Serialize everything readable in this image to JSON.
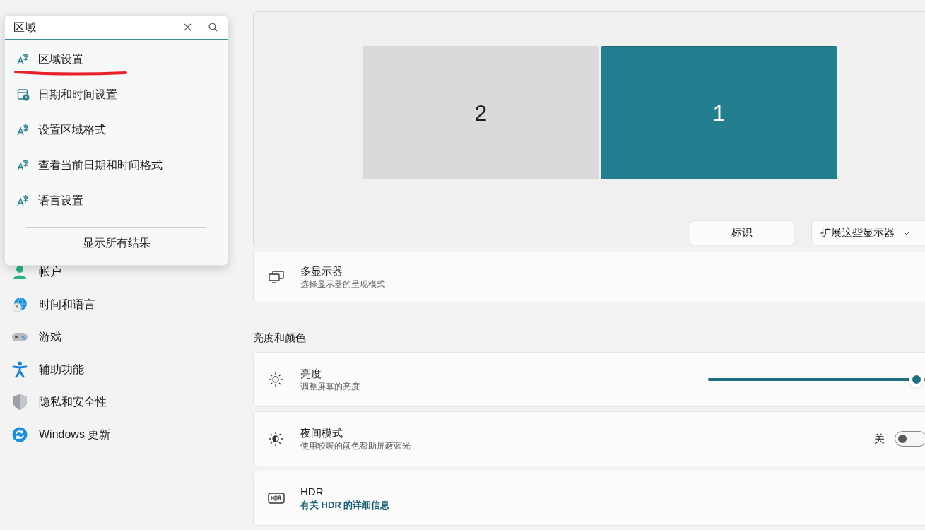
{
  "search": {
    "value": "区域",
    "results": [
      {
        "kind": "language",
        "label": "区域设置",
        "underlined": true
      },
      {
        "kind": "calendar",
        "label": "日期和时间设置",
        "underlined": false
      },
      {
        "kind": "language",
        "label": "设置区域格式",
        "underlined": false
      },
      {
        "kind": "language",
        "label": "查看当前日期和时间格式",
        "underlined": false
      },
      {
        "kind": "language",
        "label": "语言设置",
        "underlined": false
      }
    ],
    "show_all": "显示所有结果"
  },
  "sidebar": {
    "items": [
      {
        "kind": "account",
        "label": "帐户"
      },
      {
        "kind": "time",
        "label": "时间和语言"
      },
      {
        "kind": "gaming",
        "label": "游戏"
      },
      {
        "kind": "accessibility",
        "label": "辅助功能"
      },
      {
        "kind": "privacy",
        "label": "隐私和安全性"
      },
      {
        "kind": "update",
        "label": "Windows 更新"
      }
    ]
  },
  "display": {
    "monitors": [
      {
        "label": "2",
        "selected": false
      },
      {
        "label": "1",
        "selected": true
      }
    ],
    "identify": "标识",
    "mode": "扩展这些显示器"
  },
  "multi_display": {
    "title": "多显示器",
    "subtitle": "选择显示器的呈现模式"
  },
  "section": "亮度和颜色",
  "settings": [
    {
      "kind": "slider",
      "title": "亮度",
      "subtitle": "调整屏幕的亮度",
      "level": 0.95
    },
    {
      "kind": "toggle",
      "title": "夜间模式",
      "subtitle": "使用较暖的颜色帮助屏蔽蓝光",
      "on": false,
      "state_label": "关"
    },
    {
      "kind": "link",
      "title": "HDR",
      "link": "有关 HDR 的详细信息"
    }
  ]
}
